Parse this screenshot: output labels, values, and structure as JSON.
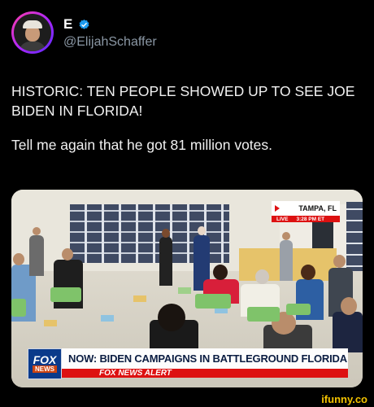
{
  "author": {
    "display_name": "E",
    "handle": "@ElijahSchaffer",
    "avatar_icon": "profile-avatar",
    "verified_icon": "verified-badge-icon",
    "verified_color": "#1d9bf0"
  },
  "tweet": {
    "line1": "HISTORIC: TEN PEOPLE SHOWED UP TO SEE JOE BIDEN IN FLORIDA!",
    "line2": "Tell me again that he got 81 million votes."
  },
  "media": {
    "location": "TAMPA, FL",
    "live_label": "LIVE",
    "time": "3:28 PM ET",
    "network_logo_top": "FOX",
    "network_logo_bottom": "NEWS",
    "headline": "NOW: BIDEN CAMPAIGNS IN BATTLEGROUND FLORIDA",
    "alert": "FOX NEWS ALERT",
    "alert_color": "#d11111"
  },
  "watermark": "ifunny.co"
}
